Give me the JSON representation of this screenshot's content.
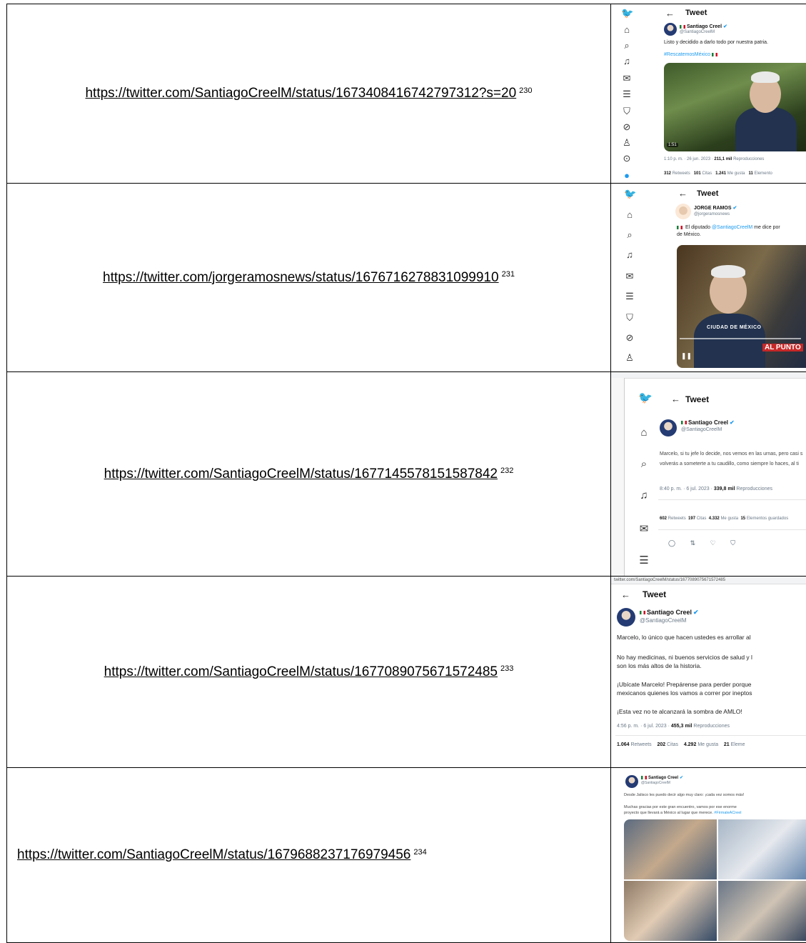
{
  "rows": [
    {
      "url": "https://twitter.com/SantiagoCreelM/status/1673408416742797312?s=20",
      "footnote": "230",
      "shot": {
        "header": "Tweet",
        "name": "Santiago Creel",
        "handle": "@SantiagoCreelM",
        "text": "Listo y decidido a darlo todo por nuestra patria.",
        "hashtag": "#RescatemosMéxico",
        "duration": "1:51",
        "timestamp": "1:10 p. m. · 26 jun. 2023 · ",
        "views": "211,1 mil",
        "views_label": " Reproducciones",
        "stats": [
          {
            "value": "312",
            "label": "Retweets"
          },
          {
            "value": "101",
            "label": "Citas"
          },
          {
            "value": "1.241",
            "label": "Me gusta"
          },
          {
            "value": "11",
            "label": "Elemento"
          }
        ]
      }
    },
    {
      "url": "https://twitter.com/jorgeramosnews/status/1676716278831099910",
      "footnote": "231",
      "shot": {
        "header": "Tweet",
        "name": "JORGE RAMOS",
        "handle": "@jorgeramosnews",
        "text_pre": " El diputado ",
        "mention": "@SantiagoCreelM",
        "text_post": " me dice por",
        "text_line2": "de México.",
        "video_caption": "CIUDAD DE MÉXICO",
        "brand": "AL PUNTO"
      }
    },
    {
      "url": "https://twitter.com/SantiagoCreelM/status/1677145578151587842",
      "footnote": "232",
      "shot": {
        "header": "Tweet",
        "name": "Santiago Creel",
        "handle": "@SantiagoCreelM",
        "line1": "Marcelo, si tu jefe lo decide, nos vemos en las urnas, pero casi s",
        "line2": "volverás a someterte a tu caudillo, como siempre lo haces, al ti",
        "timestamp": "8:40 p. m. · 6 jul. 2023 · ",
        "views": "339,8 mil",
        "views_label": " Reproducciones",
        "stats": [
          {
            "value": "602",
            "label": "Retweets"
          },
          {
            "value": "197",
            "label": "Citas"
          },
          {
            "value": "4.332",
            "label": "Me gusta"
          },
          {
            "value": "15",
            "label": "Elementos guardados"
          }
        ]
      }
    },
    {
      "url": "https://twitter.com/SantiagoCreelM/status/1677089075671572485",
      "footnote": "233",
      "shot": {
        "address": "twitter.com/SantiagoCreelM/status/1677089075671572485",
        "header": "Tweet",
        "name": "Santiago Creel",
        "handle": "@SantiagoCreelM",
        "p1": "Marcelo, lo único que hacen ustedes es arrollar al",
        "p2a": "No hay medicinas, ni buenos servicios de salud y l",
        "p2b": "son los más altos de la historia.",
        "p3a": "¡Ubícate Marcelo! Prepárense para perder porque",
        "p3b": "mexicanos quienes los vamos a correr por ineptos",
        "p4": "¡Esta vez no te alcanzará la sombra de AMLO!",
        "timestamp": "4:56 p. m. · 6 jul. 2023 · ",
        "views": "455,3 mil",
        "views_label": " Reproducciones",
        "stats": [
          {
            "value": "1.064",
            "label": "Retweets"
          },
          {
            "value": "202",
            "label": "Citas"
          },
          {
            "value": "4.292",
            "label": "Me gusta"
          },
          {
            "value": "21",
            "label": "Eleme"
          }
        ]
      }
    },
    {
      "url": "https://twitter.com/SantiagoCreelM/status/1679688237176979456",
      "footnote": "234",
      "shot": {
        "name": "Santiago Creel",
        "handle": "@SantiagoCreelM",
        "line1": "Desde Jalisco les puedo decir algo muy claro: ¡cada vez somos más!",
        "line2": "Muchas gracias por este gran encuentro, vamos por ese enorme",
        "line3": "proyecto que llevará a México al lugar que merece. ",
        "hashtag": "#FirmaleACreel"
      }
    }
  ]
}
